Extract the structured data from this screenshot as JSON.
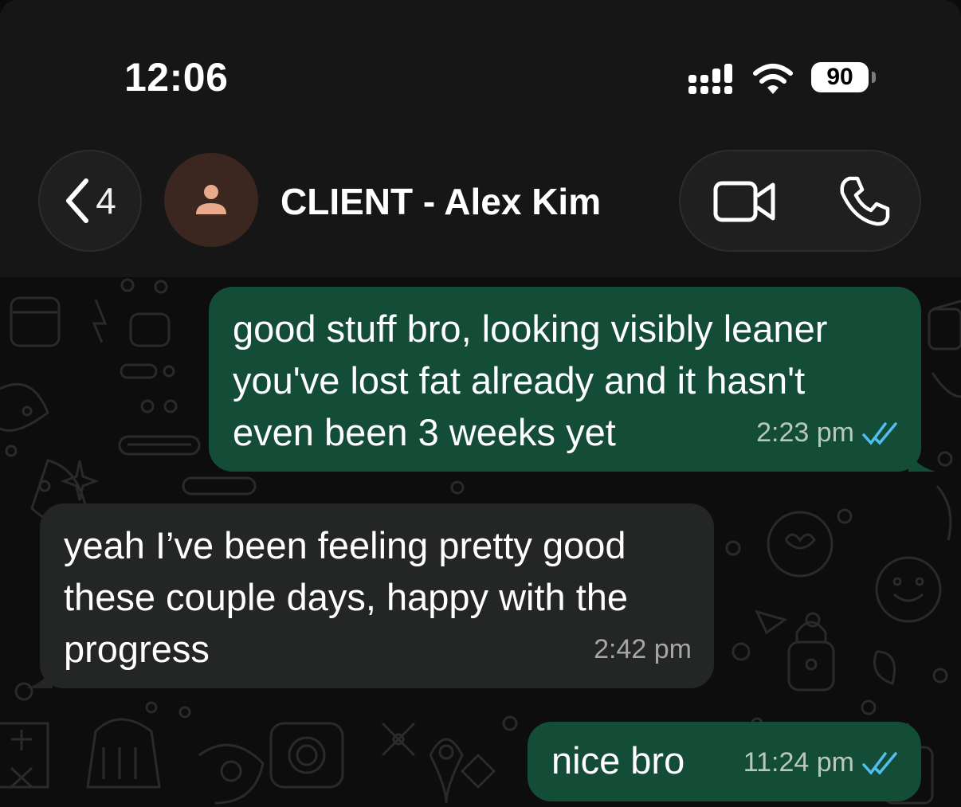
{
  "status_bar": {
    "time": "12:06",
    "battery_level": "90",
    "icons": [
      "signal-icon",
      "wifi-icon",
      "battery-icon"
    ]
  },
  "header": {
    "back_count": "4",
    "contact_name": "CLIENT - Alex Kim",
    "icons": [
      "chevron-left-icon",
      "person-icon",
      "video-camera-icon",
      "phone-icon"
    ]
  },
  "messages": [
    {
      "direction": "outgoing",
      "lines": [
        "good stuff bro, looking visibly leaner",
        "you've lost fat already and it hasn't",
        "even been 3 weeks yet"
      ],
      "time": "2:23 pm",
      "status": "read"
    },
    {
      "direction": "incoming",
      "lines": [
        "yeah I’ve been feeling pretty good",
        "these couple days, happy with the",
        "progress"
      ],
      "time": "2:42 pm"
    },
    {
      "direction": "outgoing",
      "lines": [
        "nice bro"
      ],
      "time": "11:24 pm",
      "status": "read"
    }
  ],
  "colors": {
    "outgoing_bubble": "#144d37",
    "incoming_bubble": "#242626",
    "read_ticks": "#53bdeb",
    "background": "#0d0d0d"
  }
}
